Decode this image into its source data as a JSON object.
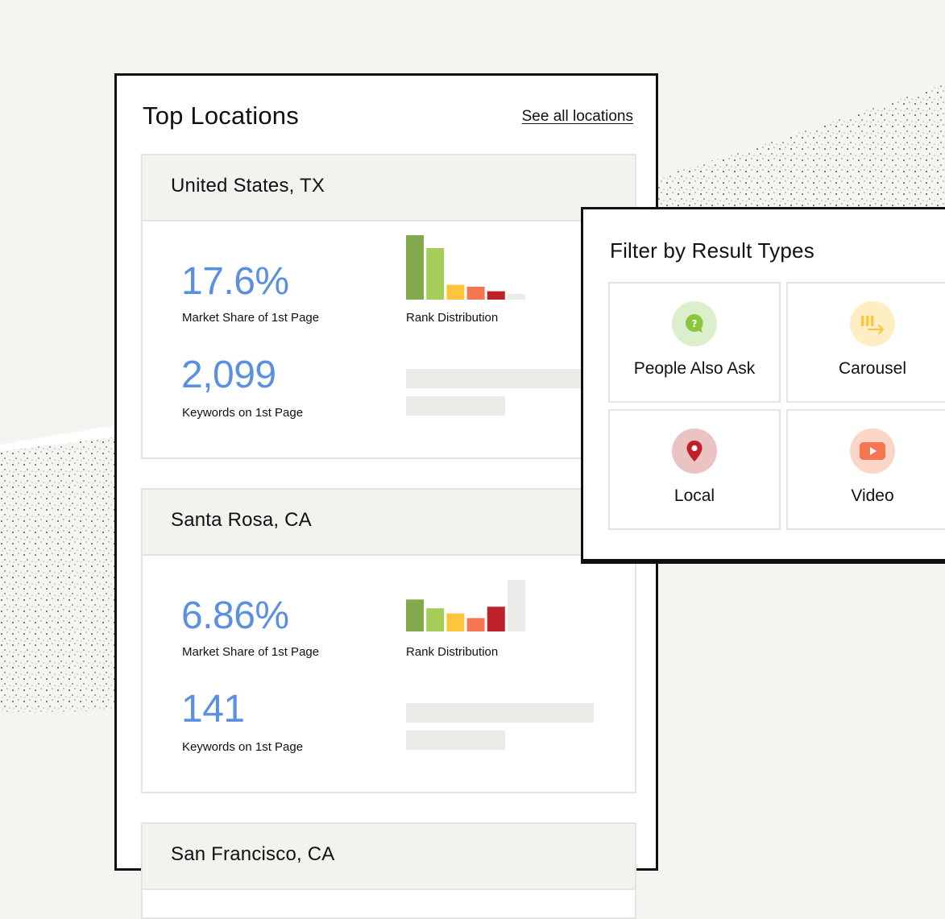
{
  "colors": {
    "accent_blue": "#5b8fe0",
    "rank_colors": [
      "#82aa4c",
      "#a4cd5a",
      "#fcc53c",
      "#f47550",
      "#bf2129",
      "#ebebe8"
    ]
  },
  "top_locations": {
    "title": "Top Locations",
    "see_all_label": "See all locations",
    "locations": [
      {
        "name": "United States, TX",
        "market_share": "17.6%",
        "market_share_label": "Market Share of 1st Page",
        "keywords": "2,099",
        "keywords_label": "Keywords on 1st Page",
        "rank_label": "Rank Distribution",
        "rank_distribution": [
          1.0,
          0.8,
          0.23,
          0.2,
          0.13,
          0.09
        ]
      },
      {
        "name": "Santa Rosa, CA",
        "market_share": "6.86%",
        "market_share_label": "Market Share of 1st Page",
        "keywords": "141",
        "keywords_label": "Keywords on 1st Page",
        "rank_label": "Rank Distribution",
        "rank_distribution": [
          0.62,
          0.45,
          0.35,
          0.26,
          0.48,
          1.0
        ]
      },
      {
        "name": "San Francisco, CA"
      }
    ]
  },
  "filter": {
    "title": "Filter by Result Types",
    "types": [
      {
        "label": "People Also Ask",
        "icon": "question-bubble-icon",
        "color": "#8cc63f",
        "bg": "#dcefcc"
      },
      {
        "label": "Carousel",
        "icon": "carousel-icon",
        "color": "#fcc53c",
        "bg": "#fdefc3"
      },
      {
        "label": "Local",
        "icon": "map-pin-icon",
        "color": "#bf2129",
        "bg": "#ecc3c3"
      },
      {
        "label": "Video",
        "icon": "video-play-icon",
        "color": "#f47550",
        "bg": "#fbd5c6"
      }
    ]
  }
}
